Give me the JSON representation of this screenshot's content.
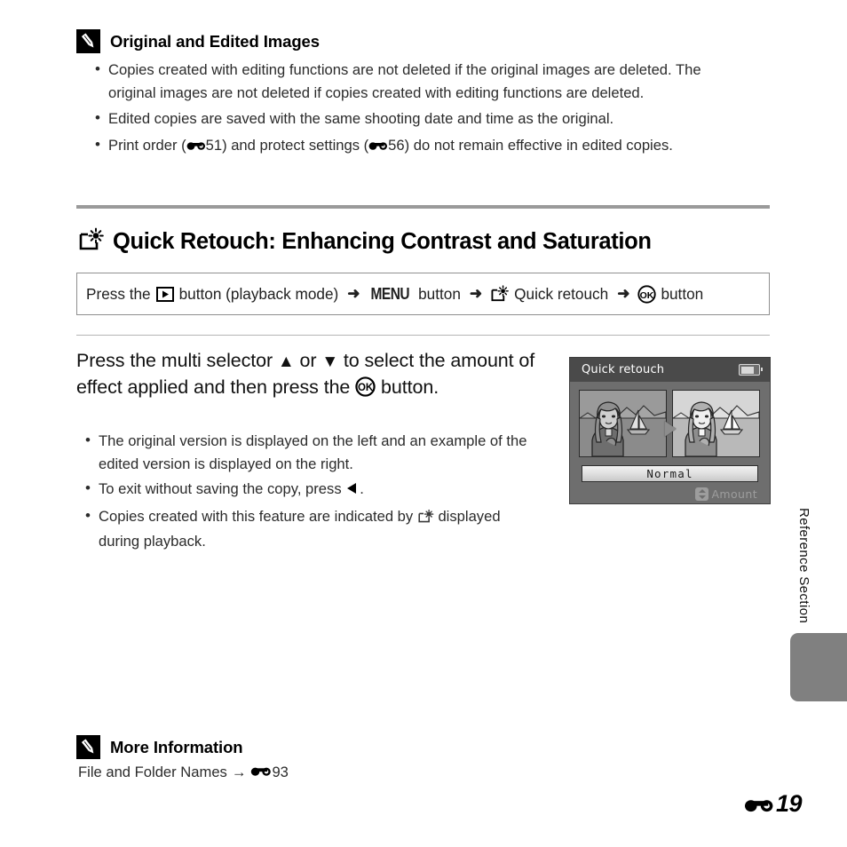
{
  "page": {
    "number_label": "19",
    "number_prefix_icon": "e-reference-icon",
    "side_tab_label": "Reference Section"
  },
  "note_top": {
    "icon": "pencil-note-icon",
    "title": "Original and Edited Images",
    "bullets": [
      {
        "parts": [
          {
            "type": "text",
            "value": "Copies created with editing functions are not deleted if the original images are deleted. The original images are not deleted if copies created with editing functions are deleted."
          }
        ]
      },
      {
        "parts": [
          {
            "type": "text",
            "value": "Edited copies are saved with the same shooting date and time as the original."
          }
        ]
      },
      {
        "parts": [
          {
            "type": "text",
            "value": "Print order ("
          },
          {
            "type": "icon",
            "value": "e-reference-icon"
          },
          {
            "type": "text",
            "value": "51) and protect settings ("
          },
          {
            "type": "icon",
            "value": "e-reference-icon"
          },
          {
            "type": "text",
            "value": "56) do not remain effective in edited copies."
          }
        ]
      }
    ],
    "bullet_1_text": "Copies created with editing functions are not deleted if the original images are deleted. The original images are not deleted if copies created with editing functions are deleted.",
    "bullet_2_text": "Edited copies are saved with the same shooting date and time as the original.",
    "bullet_3_pre": "Print order (",
    "bullet_3_mid": "51) and protect settings (",
    "bullet_3_post": "56) do not remain effective in edited copies."
  },
  "section": {
    "icon": "quick-retouch-icon",
    "heading": "Quick Retouch: Enhancing Contrast and Saturation"
  },
  "procedure": {
    "seg_1": "Press the",
    "icon_1": "playback-button-icon",
    "seg_2": "button (playback mode)",
    "arrow_1": "➜",
    "menu_word": "MENU",
    "seg_3": "button",
    "arrow_2": "➜",
    "icon_2": "quick-retouch-icon",
    "seg_4": "Quick retouch",
    "arrow_3": "➜",
    "icon_3": "ok-button-icon",
    "seg_5": "button"
  },
  "step": {
    "line_1_pre": "Press the multi selector",
    "up_arrow": "▲",
    "line_1_mid": "or",
    "down_arrow": "▼",
    "line_1_post": "to select the",
    "line_2": "amount of effect applied and then press the",
    "ok_icon": "ok-button-icon",
    "line_3": "button."
  },
  "step_bullets": {
    "b1": "The original version is displayed on the left and an example of the edited version is displayed on the right.",
    "b2_pre": "To exit without saving the copy, press",
    "b2_icon": "left-arrow-icon",
    "b2_post": ".",
    "b3_pre": "Copies created with this feature are indicated by",
    "b3_icon": "quick-retouch-indicator-icon",
    "b3_post": "displayed during playback."
  },
  "camera_screen": {
    "title": "Quick retouch",
    "battery_icon": "battery-icon",
    "left_preview_caption": "original-preview",
    "right_preview_caption": "edited-preview",
    "arrow_icon": "right-arrow-icon",
    "amount_value": "Normal",
    "amount_label": "Amount",
    "amount_icon": "up-down-arrow-icon",
    "colors": {
      "screen_bg": "#6e6e6e",
      "header_bg": "#4a4a4a",
      "title_text": "#ffffff",
      "amount_text": "#9d9d9d"
    }
  },
  "note_bottom": {
    "icon": "pencil-note-icon",
    "title": "More Information",
    "link_text": "File and Folder Names",
    "arrow": "→",
    "ref_icon": "e-reference-icon",
    "ref_page": "93"
  }
}
